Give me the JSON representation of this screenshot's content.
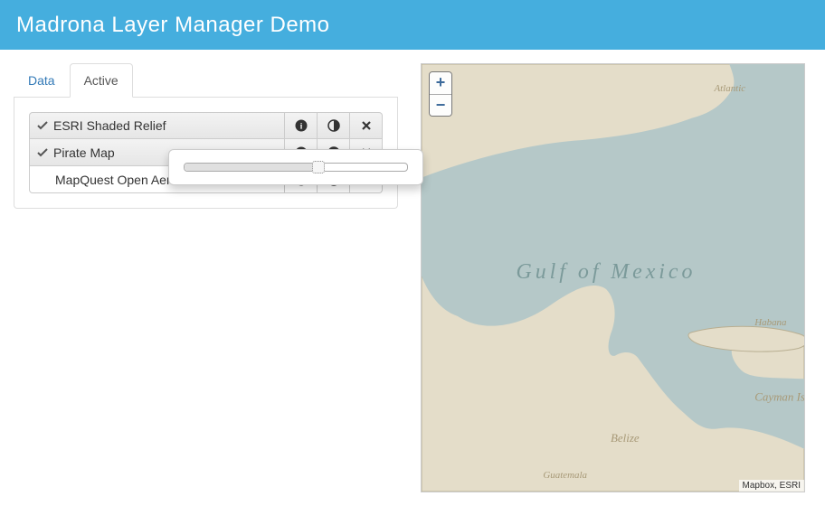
{
  "header": {
    "title": "Madrona Layer Manager Demo"
  },
  "tabs": {
    "data_label": "Data",
    "active_label": "Active"
  },
  "layers": [
    {
      "name": "ESRI Shaded Relief",
      "active": true
    },
    {
      "name": "Pirate Map",
      "active": true
    },
    {
      "name": "MapQuest Open Aerial",
      "active": false
    }
  ],
  "opacity_slider": {
    "value_percent": 60
  },
  "map": {
    "zoom_in": "+",
    "zoom_out": "−",
    "attribution": "Mapbox, ESRI",
    "labels": {
      "gulf": "Gulf of Mexico",
      "atlantic": "Atlantic",
      "habana": "Habana",
      "cayman": "Cayman Is.",
      "belize": "Belize",
      "guatemala": "Guatemala"
    }
  }
}
